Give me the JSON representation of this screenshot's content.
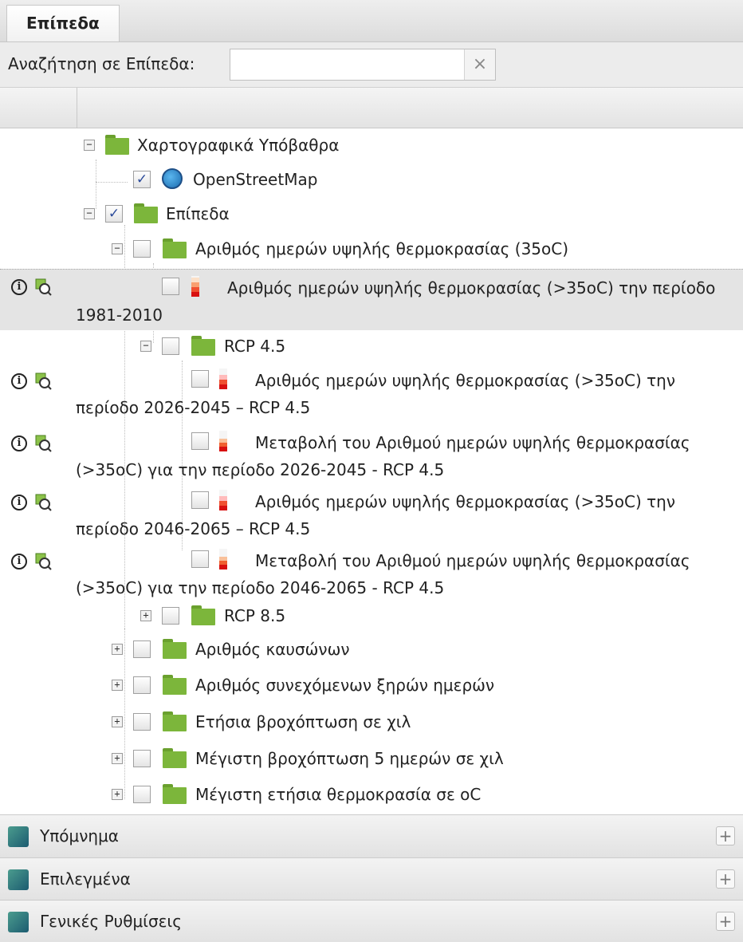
{
  "tab": {
    "label": "Επίπεδα"
  },
  "search": {
    "label": "Αναζήτηση σε Επίπεδα:",
    "value": "",
    "clear": "×"
  },
  "tree": {
    "basemaps": "Χαρτογραφικά Υπόβαθρα",
    "osm": "OpenStreetMap",
    "layers": "Επίπεδα",
    "group35": "Αριθμός ημερών υψηλής θερμοκρασίας (35oC)",
    "l1": "Αριθμός ημερών υψηλής θερμοκρασίας (>35oC) την περίοδο 1981-2010",
    "rcp45": "RCP 4.5",
    "l2": "Αριθμός ημερών υψηλής θερμοκρασίας (>35oC) την περίοδο 2026-2045 – RCP 4.5",
    "l3": "Μεταβολή του Αριθμού ημερών υψηλής θερμοκρασίας (>35oC) για την περίοδο 2026-2045 - RCP 4.5",
    "l4": "Αριθμός ημερών υψηλής θερμοκρασίας (>35oC) την περίοδο 2046-2065 – RCP 4.5",
    "l5": "Μεταβολή του Αριθμού ημερών υψηλής θερμοκρασίας (>35oC) για την περίοδο 2046-2065 - RCP 4.5",
    "rcp85": "RCP 8.5",
    "g1": "Αριθμός καυσώνων",
    "g2": "Αριθμός συνεχόμενων ξηρών ημερών",
    "g3": "Ετήσια βροχόπτωση σε χιλ",
    "g4": "Μέγιστη βροχόπτωση 5 ημερών σε χιλ",
    "g5": "Μέγιστη ετήσια θερμοκρασία σε oC",
    "minus": "−",
    "plus": "+",
    "check": "✓",
    "info": "i"
  },
  "panels": {
    "legend": "Υπόμνημα",
    "selected": "Επιλεγμένα",
    "settings": "Γενικές Ρυθμίσεις",
    "plus": "+"
  },
  "colors": {
    "folder": "#7cb63b",
    "highlight": "#e4e4e4",
    "accent": "#1c6cb0"
  }
}
